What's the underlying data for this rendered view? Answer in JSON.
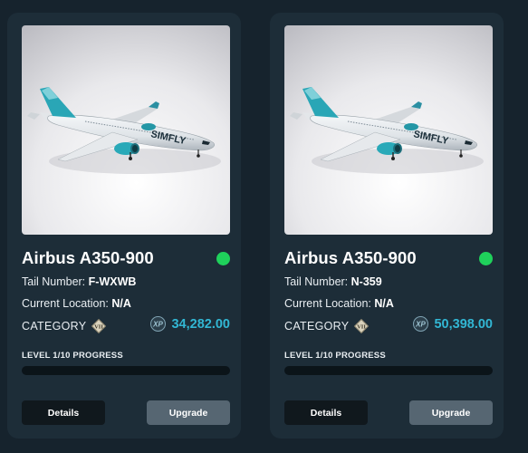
{
  "colors": {
    "page_bg": "#16232d",
    "card_bg": "#1d2d38",
    "status_active": "#1fd15b",
    "xp_accent": "#32b7d4",
    "details_button_bg": "#10181d",
    "upgrade_button_bg": "#566672",
    "progress_track": "#0b1419"
  },
  "cards": [
    {
      "title": "Airbus A350-900",
      "status": "active",
      "tail_label": "Tail Number:",
      "tail_value": "F-WXWB",
      "location_label": "Current Location:",
      "location_value": "N/A",
      "category_label": "CATEGORY",
      "category_value": "VII",
      "xp_icon": "xp-coin-icon",
      "xp_value": "34,282.00",
      "level_label": "LEVEL 1/10 PROGRESS",
      "progress_fraction": 0,
      "livery_text": "SIMFLY",
      "details_label": "Details",
      "upgrade_label": "Upgrade"
    },
    {
      "title": "Airbus A350-900",
      "status": "active",
      "tail_label": "Tail Number:",
      "tail_value": "N-359",
      "location_label": "Current Location:",
      "location_value": "N/A",
      "category_label": "CATEGORY",
      "category_value": "VII",
      "xp_icon": "xp-coin-icon",
      "xp_value": "50,398.00",
      "level_label": "LEVEL 1/10 PROGRESS",
      "progress_fraction": 0,
      "livery_text": "SIMFLY",
      "details_label": "Details",
      "upgrade_label": "Upgrade"
    }
  ]
}
